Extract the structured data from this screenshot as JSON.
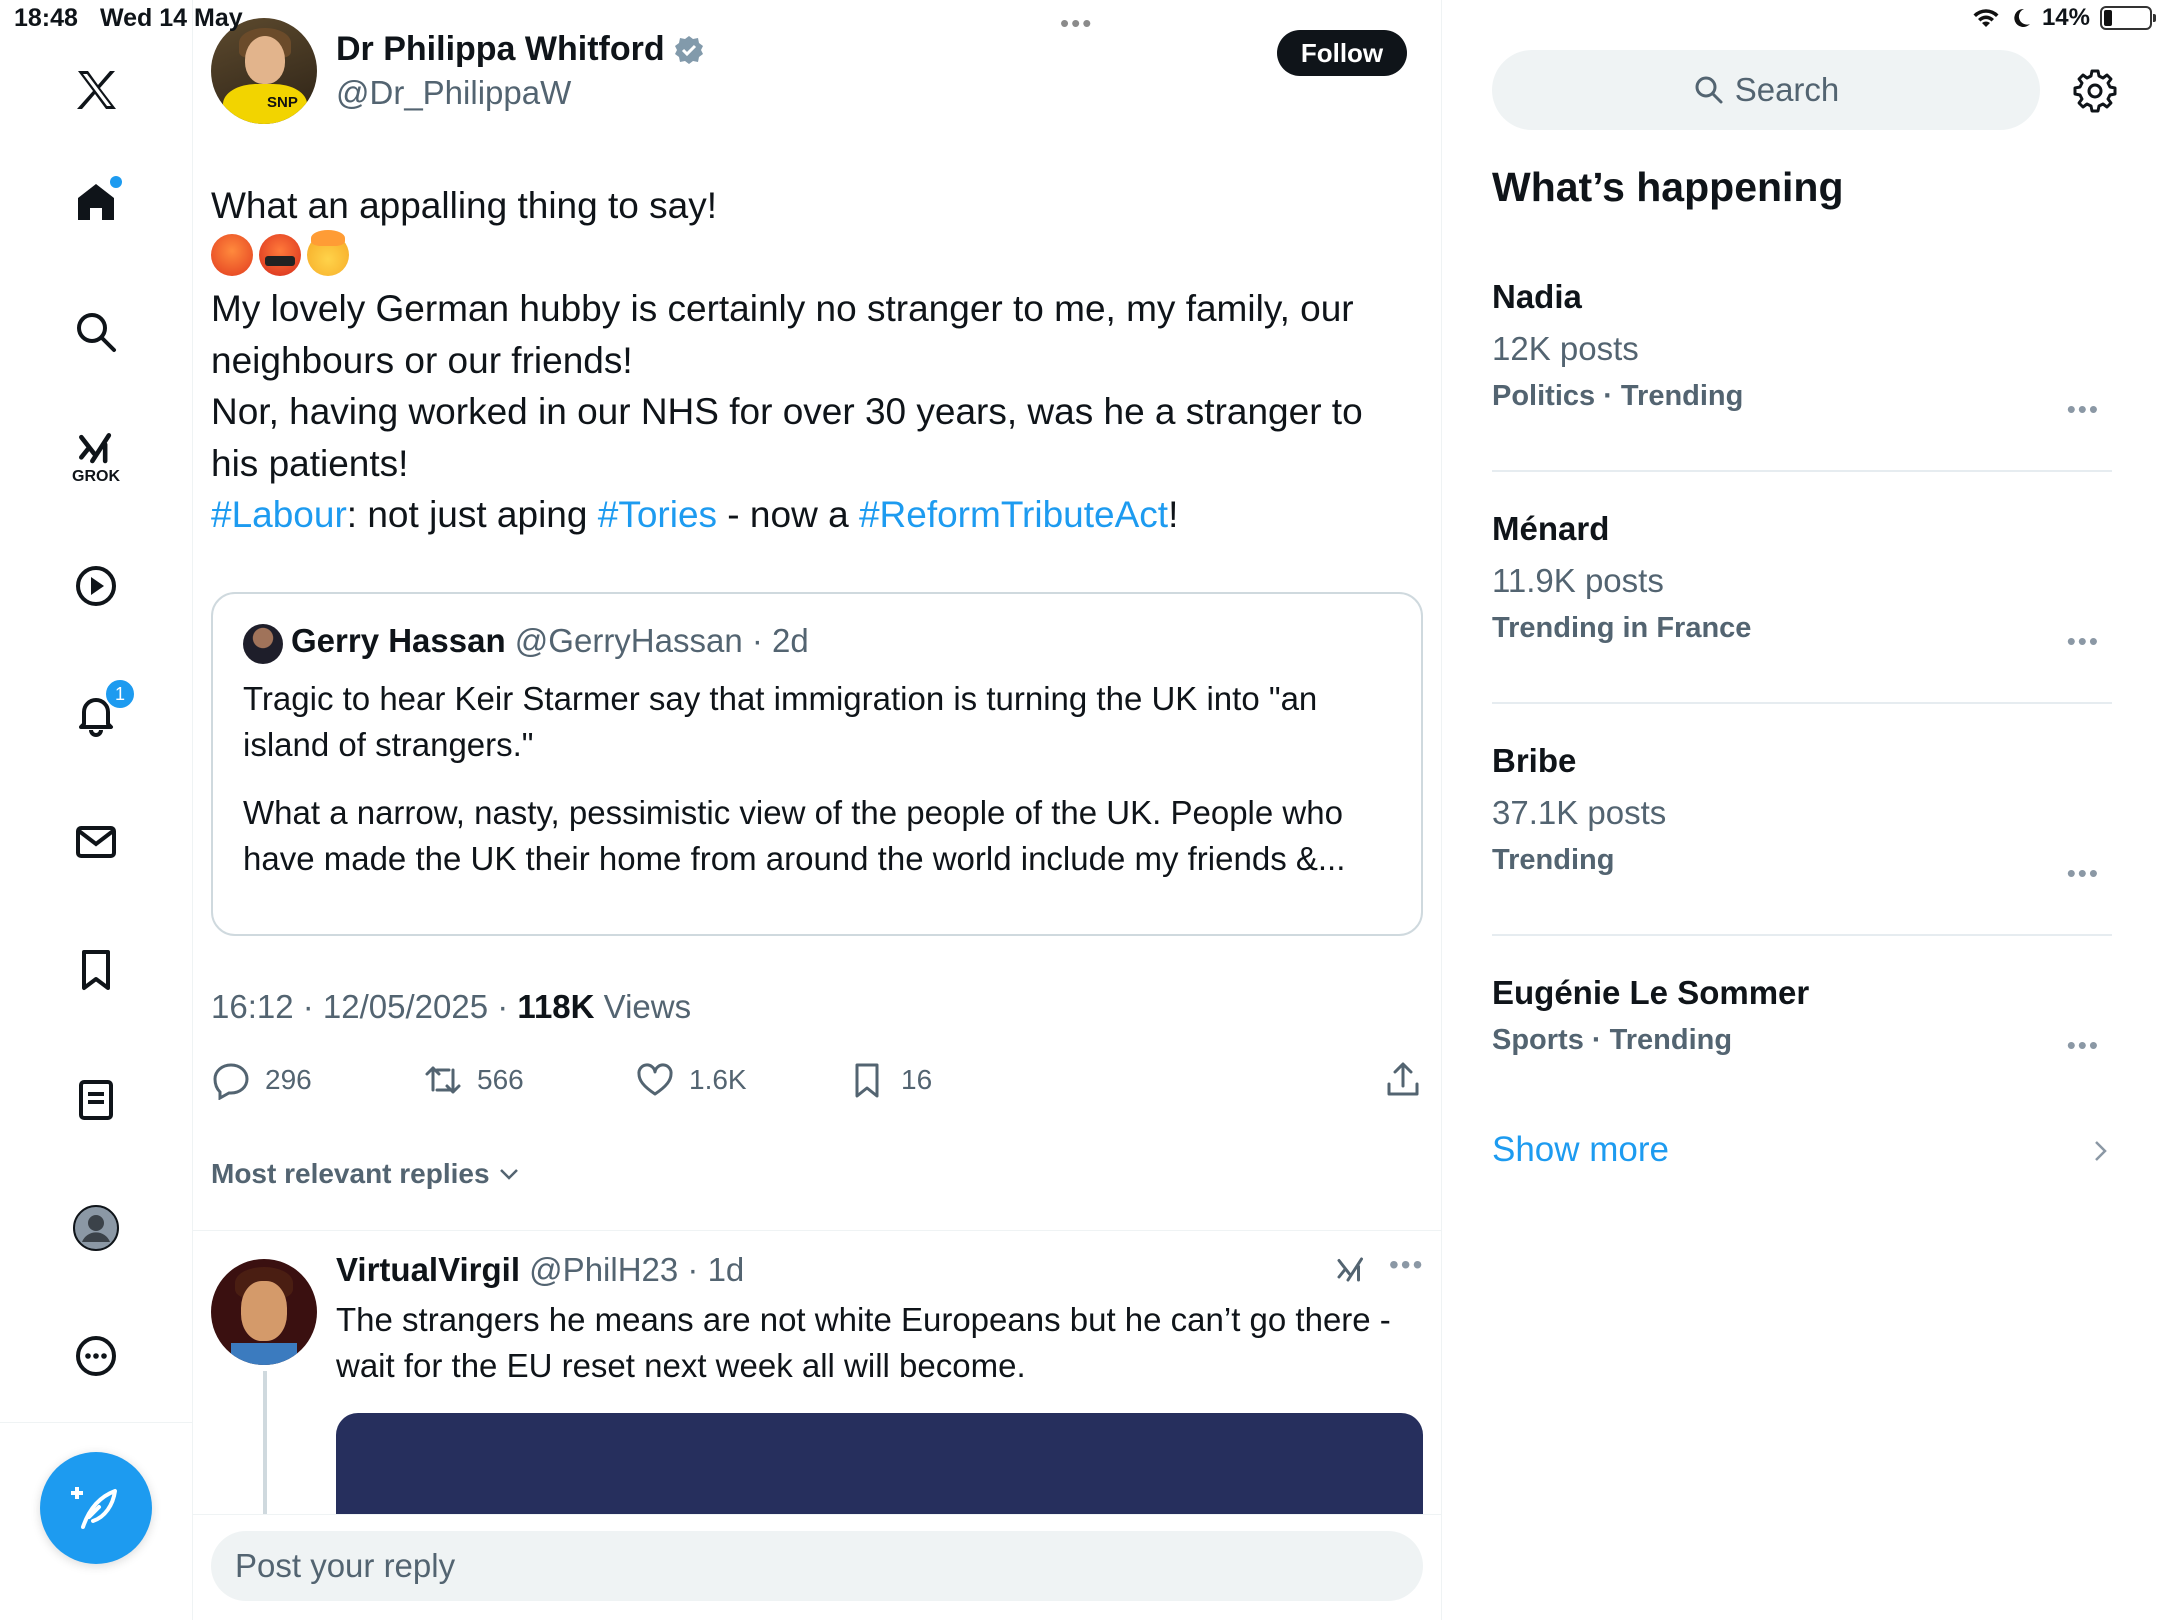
{
  "status_bar": {
    "time": "18:48",
    "date": "Wed 14 May",
    "battery": "14%"
  },
  "nav": {
    "items": [
      "home",
      "explore",
      "grok",
      "video",
      "notifications",
      "messages",
      "bookmarks",
      "lists",
      "profile",
      "more"
    ],
    "grok_label": "GROK",
    "notifications_badge": "1"
  },
  "tweet": {
    "author_name": "Dr Philippa Whitford",
    "author_handle": "@Dr_PhilippaW",
    "follow_label": "Follow",
    "avatar_badge": "SNP",
    "line1": "What an appalling thing to say!",
    "line3": "My lovely German hubby is certainly no stranger to me, my family, our",
    "line4": "neighbours or our friends!",
    "line5": "Nor, having worked in our NHS for over 30 years, was he a stranger to",
    "line6": "his patients!",
    "hashtag1": "#Labour",
    "text_mid1": ": not just aping ",
    "hashtag2": "#Tories",
    "text_mid2": " - now a ",
    "hashtag3": "#ReformTributeAct",
    "text_end": "!",
    "timestamp": "16:12 · 12/05/2025 · ",
    "views_count": "118K",
    "views_label": " Views"
  },
  "quote": {
    "name": "Gerry Hassan",
    "meta": " @GerryHassan · 2d",
    "line1": "Tragic to hear Keir Starmer say that immigration is turning the UK into \"an",
    "line2": "island of strangers.\"",
    "line3": "What a narrow, nasty, pessimistic view of the people of the UK. People who",
    "line4": "have made the UK their home from around the world include my friends &..."
  },
  "actions": {
    "replies": "296",
    "reposts": "566",
    "likes": "1.6K",
    "bookmarks": "16"
  },
  "sort_label": "Most relevant replies",
  "reply": {
    "name": "VirtualVirgil",
    "meta": " @PhilH23 · 1d",
    "line1": "The strangers he means are not white Europeans but he can’t go there -",
    "line2": "wait for the EU reset next week all will become."
  },
  "reply_placeholder": "Post your reply",
  "sidebar": {
    "search_placeholder": "Search",
    "title": "What’s happening",
    "trends": [
      {
        "name": "Nadia",
        "count": "12K posts",
        "category": "Politics · Trending"
      },
      {
        "name": "Ménard",
        "count": "11.9K posts",
        "category": "Trending in France"
      },
      {
        "name": "Bribe",
        "count": "37.1K posts",
        "category": "Trending"
      },
      {
        "name": "Eugénie Le Sommer",
        "count": "",
        "category": "Sports · Trending"
      }
    ],
    "show_more": "Show more"
  },
  "colors": {
    "accent": "#1d9bf0",
    "text": "#0f1419",
    "muted": "#536471",
    "border": "#eff3f4"
  }
}
